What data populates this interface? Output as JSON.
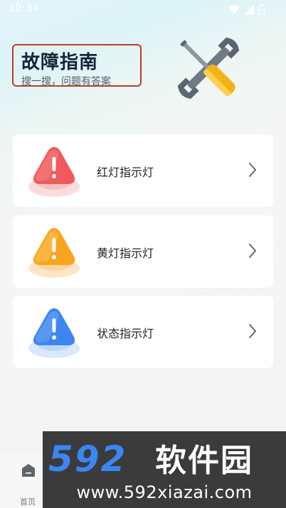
{
  "status_bar": {
    "time": "10:34",
    "icons": [
      "wifi-icon",
      "signal-icon",
      "battery-icon"
    ]
  },
  "header": {
    "title": "故障指南",
    "subtitle": "搜一搜，问题有答案",
    "illustration": "wrench-screwdriver-icon"
  },
  "cards": [
    {
      "label": "红灯指示灯",
      "icon": "red-warning-icon",
      "color": "#f05a5a"
    },
    {
      "label": "黄灯指示灯",
      "icon": "yellow-warning-icon",
      "color": "#f9a41f"
    },
    {
      "label": "状态指示灯",
      "icon": "blue-warning-icon",
      "color": "#3d86f0"
    }
  ],
  "bottom_nav": {
    "items": [
      {
        "label": "首页",
        "icon": "home-icon"
      }
    ]
  },
  "watermark": {
    "logo_text": "592软件园",
    "url": "www.592xiazai.com"
  }
}
